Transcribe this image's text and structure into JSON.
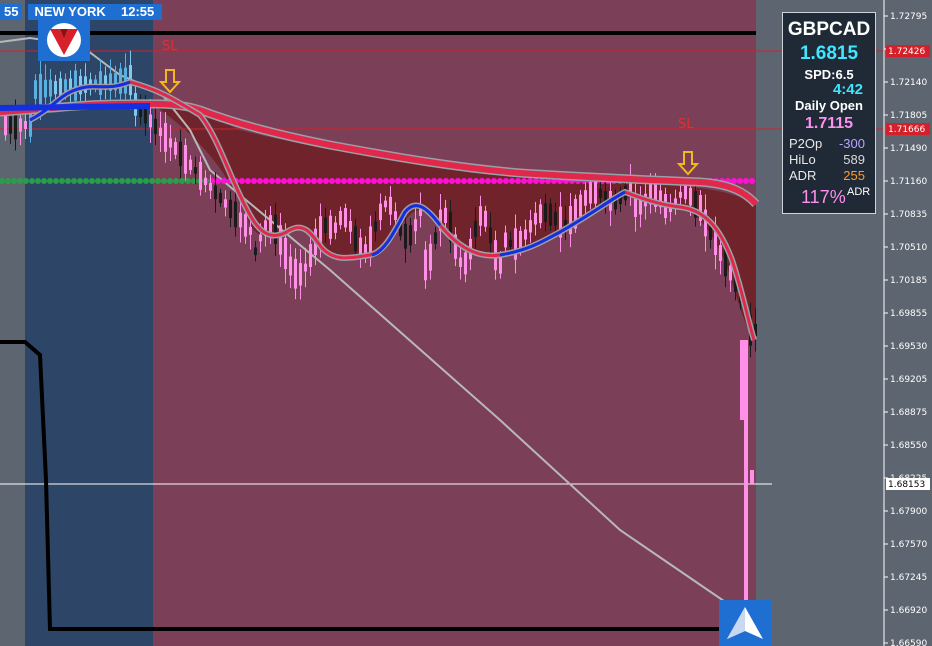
{
  "session": {
    "prev_time": "55",
    "label": "NEW YORK",
    "time": "12:55"
  },
  "panel": {
    "symbol": "GBPCAD",
    "price": "1.6815",
    "spread": "SPD:6.5",
    "countdown": "4:42",
    "daily_open_label": "Daily Open",
    "daily_open_value": "1.7115",
    "stats": [
      {
        "key": "P2Op",
        "value": "-300",
        "color": "#b9a4ff"
      },
      {
        "key": "HiLo",
        "value": "589",
        "color": "#d8d8d8"
      },
      {
        "key": "ADR",
        "value": "255",
        "color": "#ff9a2e"
      }
    ],
    "adr_percent": "117%",
    "adr_small": "ADR"
  },
  "price_axis": {
    "ticks": [
      "1.72795",
      "1.72460",
      "1.72140",
      "1.71805",
      "1.71490",
      "1.71160",
      "1.70835",
      "1.70510",
      "1.70185",
      "1.69855",
      "1.69530",
      "1.69205",
      "1.68875",
      "1.68550",
      "1.68225",
      "1.67900",
      "1.67570",
      "1.67245",
      "1.66920",
      "1.66590"
    ],
    "current_price_label": "1.68153",
    "sl_line_upper_label": "1.72426",
    "sl_line_lower_label": "1.71666"
  },
  "markers": {
    "sl_upper": "SL",
    "sl_lower": "SL"
  },
  "colors": {
    "background": "#5d6670",
    "session_blue": "#2d4566",
    "session_red": "#7b3f57",
    "cloud": "#6e1f22",
    "ma_red": "#e1284a",
    "ma_blue": "#1330e0",
    "pivot_magenta": "#ff10d8",
    "pivot_green": "#2a9d4a",
    "bear_candle": "#ff8fe8",
    "bull_candle": "#1a1a1a",
    "sl_line": "#d3202a",
    "accent_blue": "#1e6fd1"
  },
  "icons": {
    "sell_logo": "red-v-logo-icon",
    "buy_logo": "blue-arrow-logo-icon",
    "down_arrow": "down-arrow-icon"
  }
}
